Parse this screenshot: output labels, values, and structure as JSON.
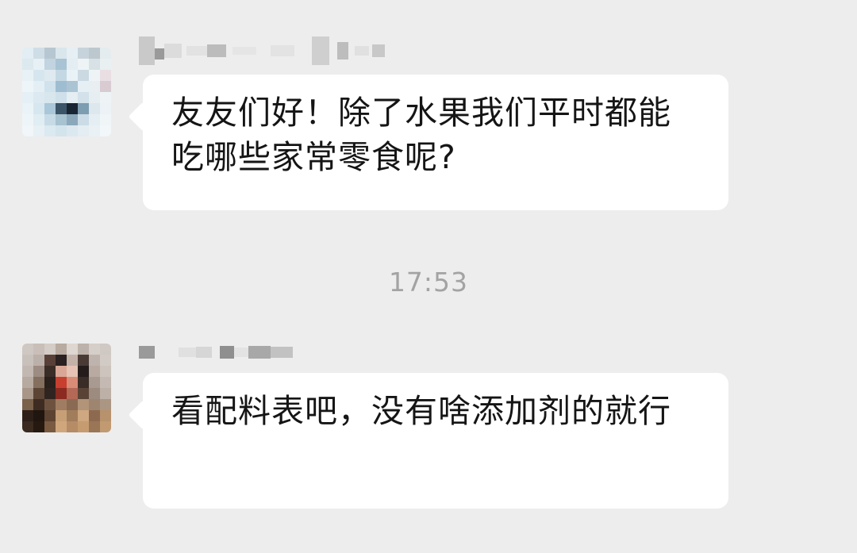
{
  "chat": {
    "messages": [
      {
        "text": "友友们好！除了水果我们平时都能吃哪些家常零食呢?"
      },
      {
        "text": "看配料表吧，没有啥添加剂的就行"
      }
    ],
    "timestamp": "17:53"
  }
}
